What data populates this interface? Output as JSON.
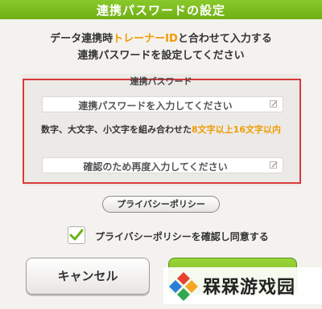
{
  "header": {
    "title": "連携パスワードの設定"
  },
  "intro": {
    "line1_pre": "データ連携時",
    "line1_highlight": "トレーナーID",
    "line1_post": "と合わせて入力する",
    "line2": "連携パスワードを設定してください"
  },
  "panel": {
    "title": "連携パスワード",
    "password_placeholder": "連携パスワードを入力してください",
    "confirm_placeholder": "確認のため再度入力してください",
    "rule_pre": "数字、大文字、小文字を組み合わせた",
    "rule_highlight": "8文字以上16文字以内"
  },
  "privacy_button": "プライバシーポリシー",
  "agree": {
    "label": "プライバシーポリシーを確認し同意する",
    "checked": true
  },
  "buttons": {
    "cancel": "キャンセル"
  },
  "watermark": {
    "text": "槑槑游戏园"
  },
  "colors": {
    "accent_green": "#7cbd1e",
    "highlight_orange": "#f09a00",
    "annotation_red": "#d83a3a"
  },
  "icons": {
    "field_icon": "edit-icon",
    "check_icon": "checkmark-icon"
  }
}
